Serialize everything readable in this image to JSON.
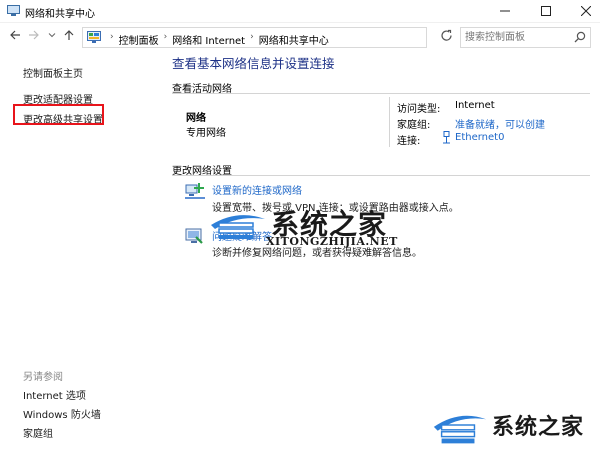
{
  "window": {
    "title": "网络和共享中心"
  },
  "address_bar": {
    "breadcrumbs": [
      "控制面板",
      "网络和 Internet",
      "网络和共享中心"
    ]
  },
  "search": {
    "placeholder": "搜索控制面板"
  },
  "sidebar": {
    "home": "控制面板主页",
    "adapter": "更改适配器设置",
    "advanced": "更改高级共享设置",
    "see_also": "另请参阅",
    "internet_options": "Internet 选项",
    "firewall": "Windows 防火墙",
    "homegroup": "家庭组"
  },
  "main": {
    "title": "查看基本网络信息并设置连接",
    "active_networks_label": "查看活动网络",
    "network": {
      "name": "网络",
      "type": "专用网络",
      "access_type_label": "访问类型:",
      "access_type_value": "Internet",
      "homegroup_label": "家庭组:",
      "homegroup_value": "准备就绪，可以创建",
      "connection_label": "连接:",
      "connection_value": "Ethernet0"
    },
    "change_settings_label": "更改网络设置",
    "tasks": [
      {
        "title": "设置新的连接或网络",
        "desc": "设置宽带、拨号或 VPN 连接；或设置路由器或接入点。"
      },
      {
        "title": "问题疑难解答",
        "desc": "诊断并修复网络问题，或者获得疑难解答信息。"
      }
    ]
  },
  "watermark": {
    "text": "系统之家",
    "url": "XITONGZHIJIA.NET"
  }
}
